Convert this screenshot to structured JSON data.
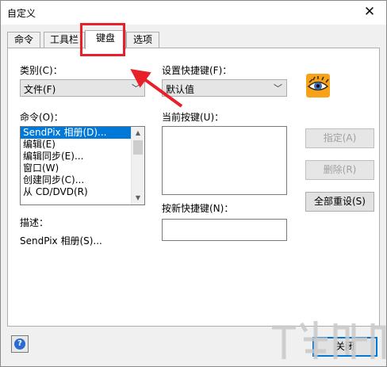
{
  "window": {
    "title": "自定义",
    "close_glyph": "✕"
  },
  "tabs": [
    {
      "label": "命令",
      "active": false
    },
    {
      "label": "工具栏",
      "active": false
    },
    {
      "label": "键盘",
      "active": true
    },
    {
      "label": "选项",
      "active": false
    }
  ],
  "category": {
    "label": "类别(C)：",
    "value": "文件(F)"
  },
  "commands": {
    "label": "命令(O)：",
    "items": [
      "SendPix 相册(D)...",
      "编辑(E)",
      "编辑同步(E)...",
      "窗口(W)",
      "创建同步(C)...",
      "从 CD/DVD(R)"
    ],
    "selected_index": 0
  },
  "shortcut_set": {
    "label": "设置快捷键(F)：",
    "value": "默认值"
  },
  "current_keys": {
    "label": "当前按键(U)："
  },
  "new_shortcut": {
    "label": "按新快捷键(N)：",
    "value": ""
  },
  "description": {
    "label": "描述：",
    "text": "SendPix 相册(S)..."
  },
  "buttons": {
    "assign": "指定(A)",
    "remove": "删除(R)",
    "reset_all": "全部重设(S)",
    "close": "关闭"
  },
  "help": {
    "glyph": "?"
  },
  "icons": {
    "app_icon": "eye-icon",
    "help_icon": "help-icon"
  },
  "colors": {
    "annotation": "#e8202a",
    "selection": "#0078d7",
    "app_icon_bg": "#f6a21a"
  }
}
